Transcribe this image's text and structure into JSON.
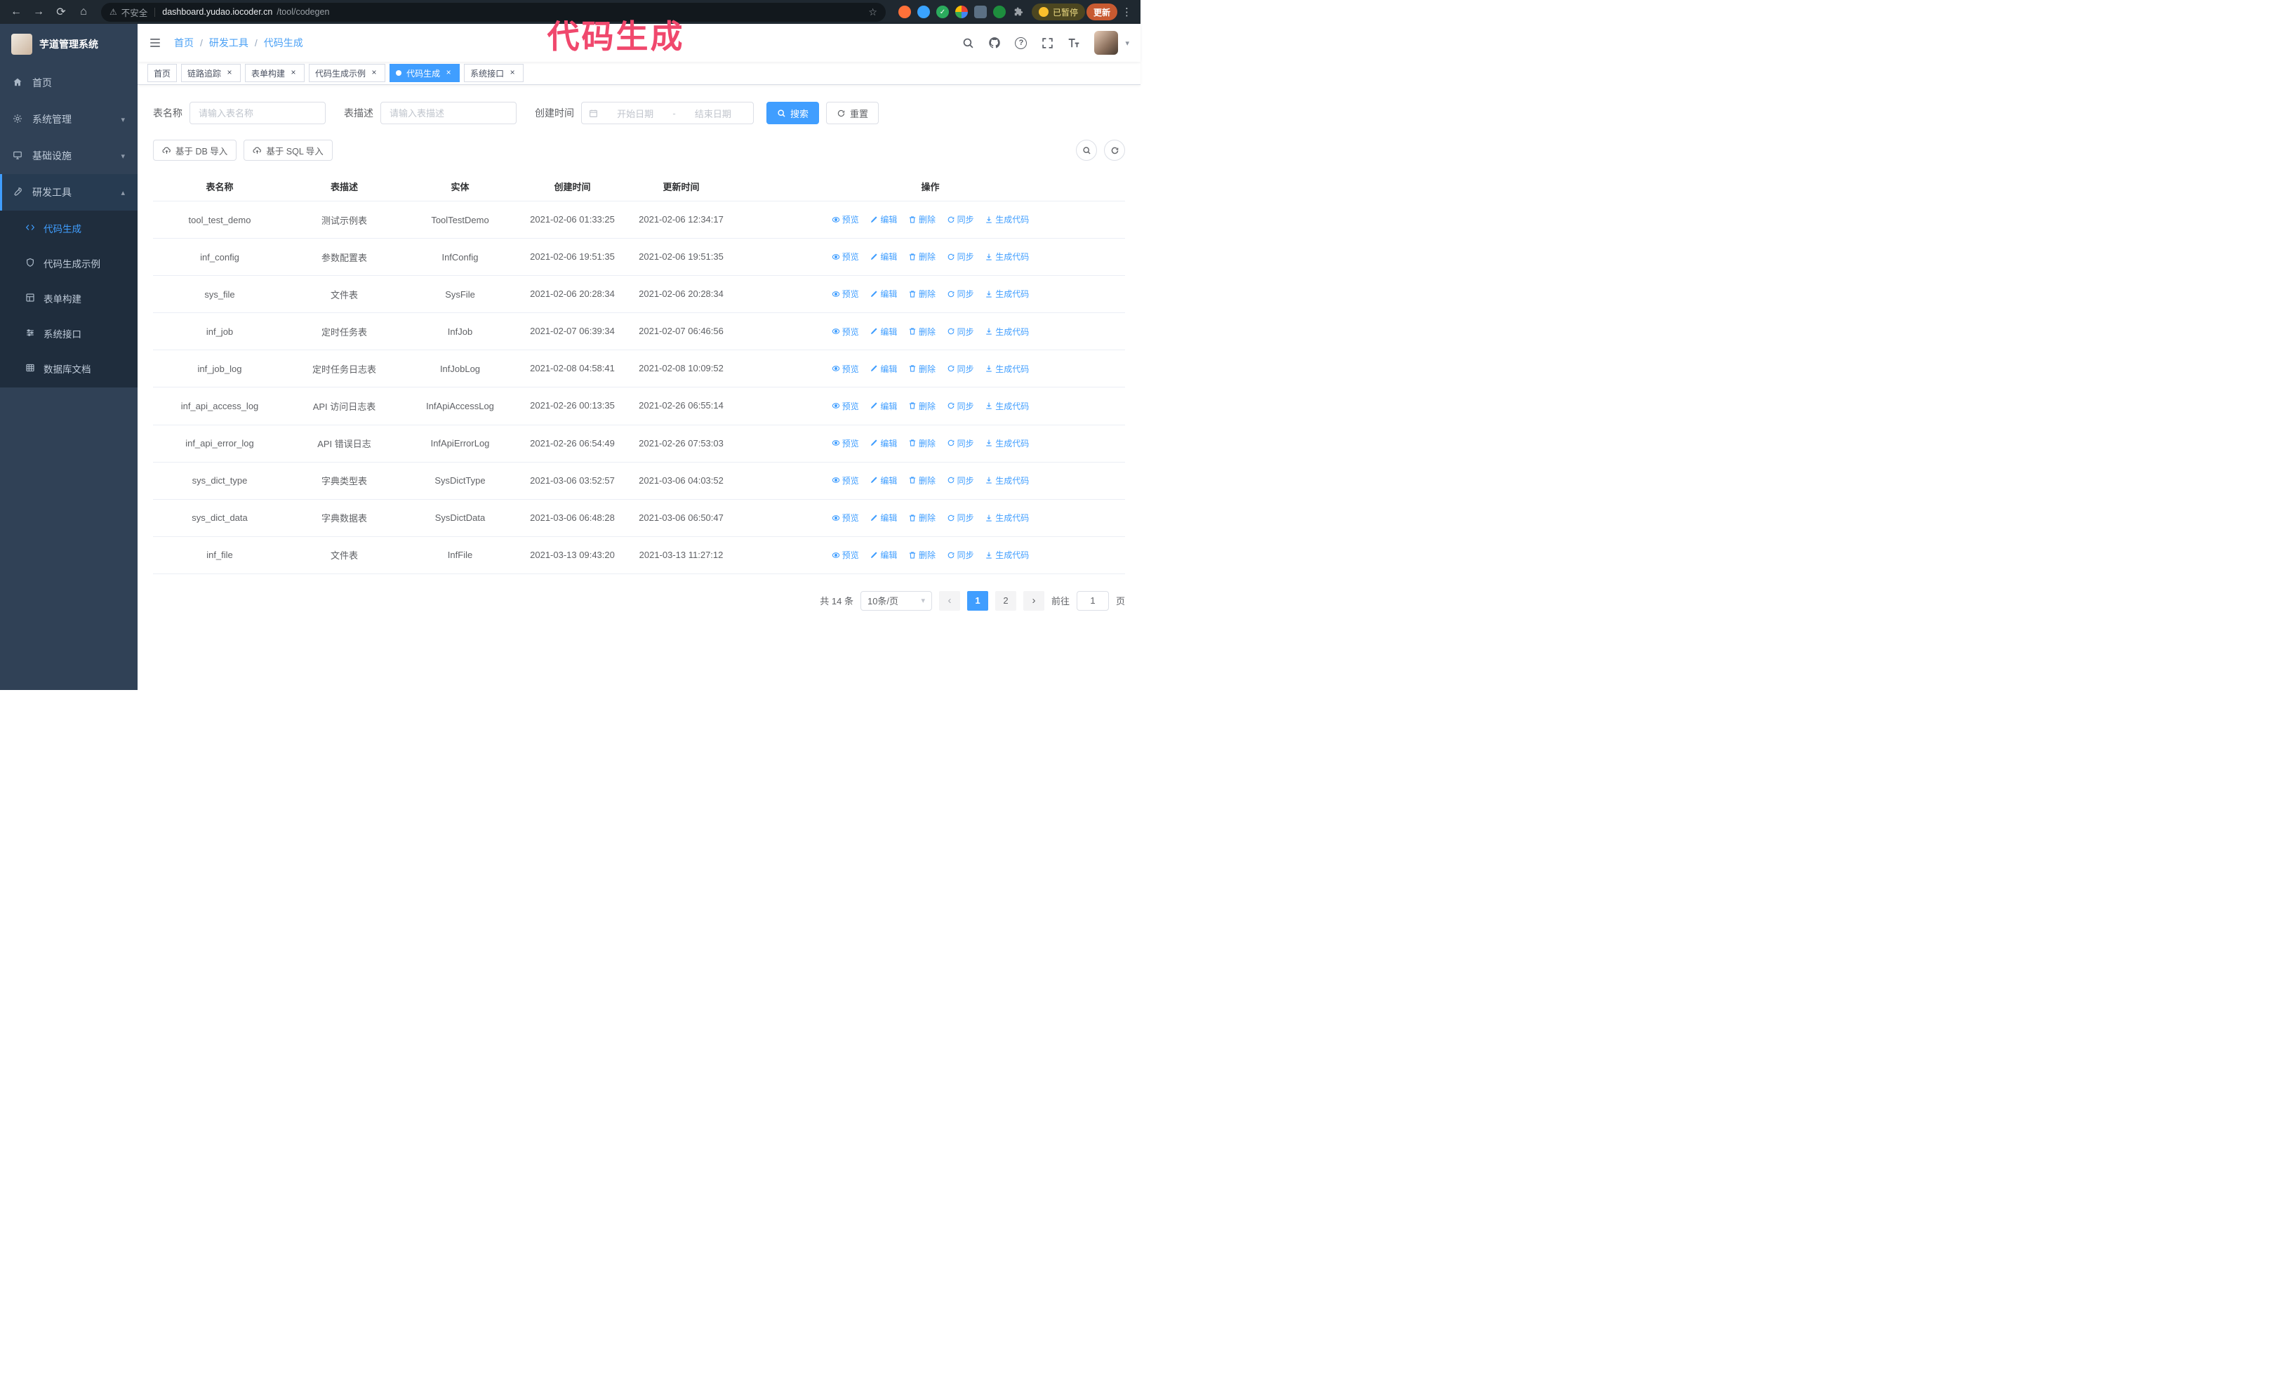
{
  "colors": {
    "accent": "#409eff",
    "annotation_pink": "#f0486d"
  },
  "icons": {
    "back": "←",
    "forward": "→",
    "reload": "⟳",
    "home": "⌂",
    "warning": "⚠",
    "star": "☆",
    "menu_dots": "⋮",
    "close": "×",
    "chevron_down": "▾",
    "chevron_up": "▴",
    "caret_down": "▾",
    "prev": "‹",
    "next": "›",
    "question": "?",
    "check": "✓"
  },
  "annotation": {
    "text": "代码生成"
  },
  "browser": {
    "security_label": "不安全",
    "url_host": "dashboard.yudao.iocoder.cn",
    "url_path": "/tool/codegen",
    "paused_badge": "已暂停",
    "update_label": "更新"
  },
  "sidebar": {
    "app_title": "芋道管理系统",
    "items": [
      {
        "label": "首页"
      },
      {
        "label": "系统管理"
      },
      {
        "label": "基础设施"
      },
      {
        "label": "研发工具"
      }
    ],
    "sub_items": [
      {
        "label": "代码生成"
      },
      {
        "label": "代码生成示例"
      },
      {
        "label": "表单构建"
      },
      {
        "label": "系统接口"
      },
      {
        "label": "数据库文档"
      }
    ]
  },
  "header": {
    "breadcrumb": [
      "首页",
      "研发工具",
      "代码生成"
    ]
  },
  "tabs": [
    {
      "label": "首页"
    },
    {
      "label": "链路追踪",
      "closable": true
    },
    {
      "label": "表单构建",
      "closable": true
    },
    {
      "label": "代码生成示例",
      "closable": true
    },
    {
      "label": "代码生成",
      "closable": true,
      "active": true
    },
    {
      "label": "系统接口",
      "closable": true
    }
  ],
  "filters": {
    "name_label": "表名称",
    "name_placeholder": "请输入表名称",
    "desc_label": "表描述",
    "desc_placeholder": "请输入表描述",
    "time_label": "创建时间",
    "start_placeholder": "开始日期",
    "range_separator": "-",
    "end_placeholder": "结束日期",
    "search_label": "搜索",
    "reset_label": "重置"
  },
  "toolbar": {
    "import_db_label": "基于 DB 导入",
    "import_sql_label": "基于 SQL 导入"
  },
  "table": {
    "columns": [
      "表名称",
      "表描述",
      "实体",
      "创建时间",
      "更新时间",
      "操作"
    ],
    "actions": [
      "预览",
      "编辑",
      "删除",
      "同步",
      "生成代码"
    ],
    "rows": [
      {
        "name": "tool_test_demo",
        "desc": "测试示例表",
        "entity": "ToolTestDemo",
        "created": "2021-02-06 01:33:25",
        "updated": "2021-02-06 12:34:17"
      },
      {
        "name": "inf_config",
        "desc": "参数配置表",
        "entity": "InfConfig",
        "created": "2021-02-06 19:51:35",
        "updated": "2021-02-06 19:51:35"
      },
      {
        "name": "sys_file",
        "desc": "文件表",
        "entity": "SysFile",
        "created": "2021-02-06 20:28:34",
        "updated": "2021-02-06 20:28:34"
      },
      {
        "name": "inf_job",
        "desc": "定时任务表",
        "entity": "InfJob",
        "created": "2021-02-07 06:39:34",
        "updated": "2021-02-07 06:46:56"
      },
      {
        "name": "inf_job_log",
        "desc": "定时任务日志表",
        "entity": "InfJobLog",
        "created": "2021-02-08 04:58:41",
        "updated": "2021-02-08 10:09:52"
      },
      {
        "name": "inf_api_access_log",
        "desc": "API 访问日志表",
        "entity": "InfApiAccessLog",
        "created": "2021-02-26 00:13:35",
        "updated": "2021-02-26 06:55:14"
      },
      {
        "name": "inf_api_error_log",
        "desc": "API 错误日志",
        "entity": "InfApiErrorLog",
        "created": "2021-02-26 06:54:49",
        "updated": "2021-02-26 07:53:03"
      },
      {
        "name": "sys_dict_type",
        "desc": "字典类型表",
        "entity": "SysDictType",
        "created": "2021-03-06 03:52:57",
        "updated": "2021-03-06 04:03:52"
      },
      {
        "name": "sys_dict_data",
        "desc": "字典数据表",
        "entity": "SysDictData",
        "created": "2021-03-06 06:48:28",
        "updated": "2021-03-06 06:50:47"
      },
      {
        "name": "inf_file",
        "desc": "文件表",
        "entity": "InfFile",
        "created": "2021-03-13 09:43:20",
        "updated": "2021-03-13 11:27:12"
      }
    ]
  },
  "pagination": {
    "total_text": "共 14 条",
    "page_size": "10条/页",
    "pages": [
      {
        "label": "1",
        "active": true
      },
      {
        "label": "2"
      }
    ],
    "goto_label": "前往",
    "goto_value": "1",
    "goto_suffix": "页"
  }
}
